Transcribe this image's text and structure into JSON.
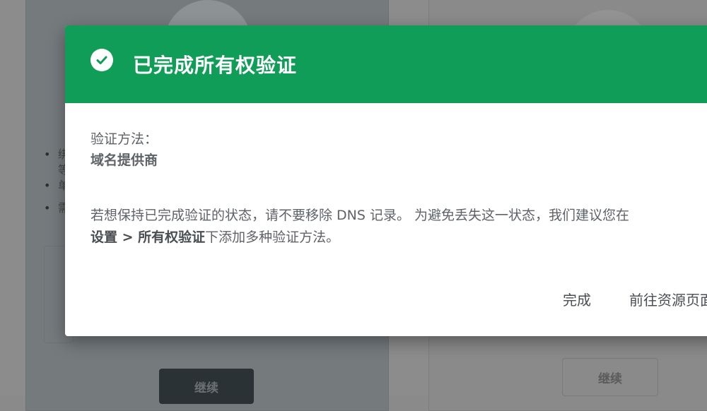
{
  "background": {
    "list_items": [
      "绑",
      "单",
      "需"
    ],
    "list_item_line2": "等",
    "continue_primary_label": "继续",
    "continue_secondary_label": "继续"
  },
  "dialog": {
    "title": "已完成所有权验证",
    "header_color": "#0f9d58",
    "icon": "check-circle-icon",
    "method_label": "验证方法：",
    "method_value": "域名提供商",
    "info_line1": "若想保持已完成验证的状态，请不要移除 DNS 记录。 为避免丢失这一状态，我们建议您在",
    "info_line2_bold": "设置 > 所有权验证",
    "info_line2_rest": "下添加多种验证方法。",
    "actions": {
      "done_label": "完成",
      "goto_label": "前往资源页面"
    }
  }
}
